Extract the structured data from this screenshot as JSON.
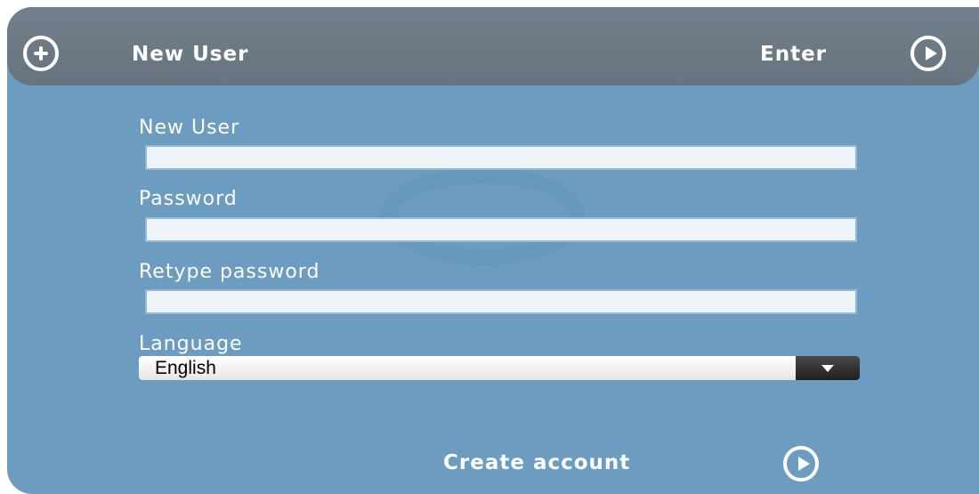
{
  "header": {
    "new_user_label": "New User",
    "new_user_icon": "plus-circle-icon",
    "enter_label": "Enter",
    "enter_icon": "play-circle-icon"
  },
  "form": {
    "username": {
      "label": "New User",
      "value": ""
    },
    "password": {
      "label": "Password",
      "value": ""
    },
    "retype_password": {
      "label": "Retype password",
      "value": ""
    },
    "language": {
      "label": "Language",
      "selected": "English",
      "icon": "chevron-down-icon"
    }
  },
  "footer": {
    "create_account_label": "Create account",
    "create_account_icon": "play-circle-icon"
  },
  "colors": {
    "panel": "#6c9cc0",
    "header": "#6b7883",
    "input_bg": "#eef3f8",
    "text": "#ffffff"
  }
}
